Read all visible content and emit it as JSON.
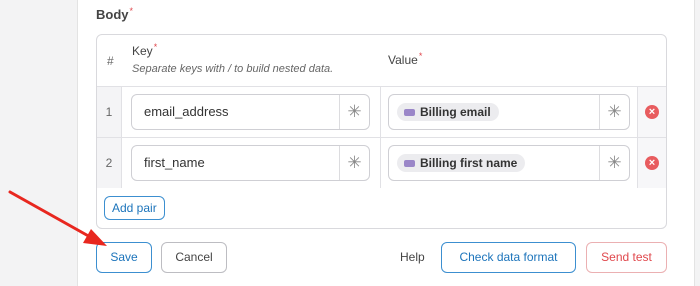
{
  "section": {
    "title": "Body",
    "required_mark": "*"
  },
  "table": {
    "headers": {
      "hash": "#",
      "key": "Key",
      "key_required": "*",
      "key_hint": "Separate keys with / to build nested data.",
      "value": "Value",
      "value_required": "*"
    },
    "rows": [
      {
        "number": "1",
        "key": "email_address",
        "value_chip": "Billing email",
        "value_chip_icon": "variable-tag-icon"
      },
      {
        "number": "2",
        "key": "first_name",
        "value_chip": "Billing first name",
        "value_chip_icon": "variable-tag-icon"
      }
    ],
    "field_button_glyph": "✳",
    "remove_glyph": "×",
    "add_pair_label": "Add pair"
  },
  "footer": {
    "save_label": "Save",
    "cancel_label": "Cancel",
    "help_label": "Help",
    "check_format_label": "Check data format",
    "send_test_label": "Send test"
  },
  "colors": {
    "accent": "#1c74bb",
    "danger": "#e0474c",
    "annotation_arrow": "#e8271f"
  }
}
